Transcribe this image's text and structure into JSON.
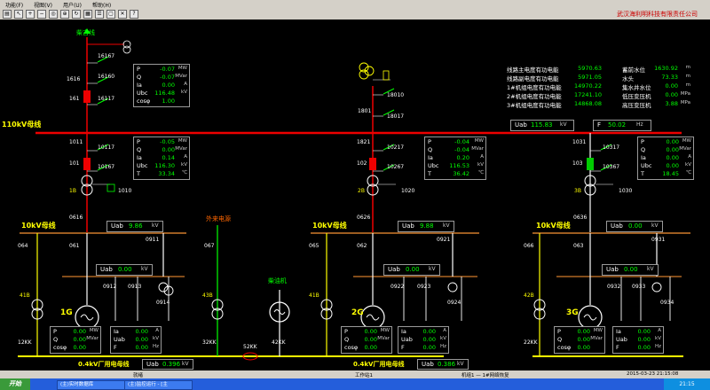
{
  "menu": {
    "items": [
      "功能(F)",
      "视图(V)",
      "用户(U)",
      "帮助(H)"
    ]
  },
  "company": "武汉海利明科技有限责任公司",
  "top": {
    "line_name": "柴古线",
    "bus110": "110kV母线",
    "uab": {
      "label": "Uab",
      "value": "115.83",
      "unit": "kV"
    },
    "f": {
      "label": "F",
      "value": "50.02",
      "unit": "Hz"
    }
  },
  "ext_power": "外来电源",
  "diesel": "柴油机",
  "bus04": "0.4kV厂用电母线",
  "switch_labels": {
    "s1616": "1616",
    "s16167": "16167",
    "s16160": "16160",
    "s16117": "16117",
    "s161": "161",
    "s1801": "1801",
    "s18010": "18010",
    "s18017": "18017",
    "s1011": "1011",
    "s10117": "10117",
    "s101": "101",
    "s10167": "10167",
    "s1B": "1B",
    "s1010": "1010",
    "s1821": "1821",
    "s10217": "10217",
    "s102": "102",
    "s10267": "10267",
    "s2B": "2B",
    "s1020": "1020",
    "s1031": "1031",
    "s10317": "10317",
    "s103": "103",
    "s10367": "10367",
    "s3B": "3B",
    "s1030": "1030",
    "s0616": "0616",
    "s0626": "0626",
    "s0636": "0636",
    "s064": "064",
    "s061": "061",
    "s0911": "0911",
    "s067": "067",
    "s065": "065",
    "s062": "062",
    "s0921": "0921",
    "s066": "066",
    "s063": "063",
    "s0931": "0931",
    "s41B_1": "41B",
    "s43B": "43B",
    "s41B_2": "41B",
    "s42B": "42B",
    "s0912": "0912",
    "s0913": "0913",
    "s0914": "0914",
    "s0922": "0922",
    "s0923": "0923",
    "s0924": "0924",
    "s0932": "0932",
    "s0933": "0933",
    "s0934": "0934",
    "s1G": "1G",
    "s2G": "2G",
    "s3G": "3G",
    "s12KK": "12KK",
    "s32KK": "32KK",
    "s52KK": "52KK",
    "s42KK": "42KK",
    "s22KK": "22KK"
  },
  "panel_line": {
    "rows": [
      {
        "k": "P",
        "v": "-0.07",
        "u": "MW"
      },
      {
        "k": "Q",
        "v": "-0.07",
        "u": "MVar"
      },
      {
        "k": "Ia",
        "v": "0.00",
        "u": "A"
      },
      {
        "k": "Ubc",
        "v": "116.48",
        "u": "kV"
      },
      {
        "k": "cosφ",
        "v": "1.00",
        "u": ""
      }
    ]
  },
  "panel_t1": {
    "rows": [
      {
        "k": "P",
        "v": "-0.05",
        "u": "MW"
      },
      {
        "k": "Q",
        "v": "0.00",
        "u": "MVar"
      },
      {
        "k": "Ia",
        "v": "0.14",
        "u": "A"
      },
      {
        "k": "Ubc",
        "v": "116.30",
        "u": "kV"
      },
      {
        "k": "T",
        "v": "33.34",
        "u": "℃"
      }
    ]
  },
  "panel_t2": {
    "rows": [
      {
        "k": "P",
        "v": "-0.04",
        "u": "MW"
      },
      {
        "k": "Q",
        "v": "-0.04",
        "u": "MVar"
      },
      {
        "k": "Ia",
        "v": "0.20",
        "u": "A"
      },
      {
        "k": "Ubc",
        "v": "116.53",
        "u": "kV"
      },
      {
        "k": "T",
        "v": "36.42",
        "u": "℃"
      }
    ]
  },
  "panel_t3": {
    "rows": [
      {
        "k": "P",
        "v": "0.00",
        "u": "MW"
      },
      {
        "k": "Q",
        "v": "0.00",
        "u": "MVar"
      },
      {
        "k": "Ia",
        "v": "0.00",
        "u": "A"
      },
      {
        "k": "Ubc",
        "v": "0.00",
        "u": "kV"
      },
      {
        "k": "T",
        "v": "18.45",
        "u": "℃"
      }
    ]
  },
  "energy": {
    "rows": [
      {
        "k": "线路主电度有功电能",
        "v": "5970.63"
      },
      {
        "k": "线路副电度有功电能",
        "v": "5971.05"
      },
      {
        "k": "1#机组电度有功电能",
        "v": "14970.22"
      },
      {
        "k": "2#机组电度有功电能",
        "v": "17241.10"
      },
      {
        "k": "3#机组电度有功电能",
        "v": "14868.08"
      }
    ]
  },
  "water": {
    "rows": [
      {
        "k": "蓄前水位",
        "v": "1630.92",
        "u": "m"
      },
      {
        "k": "水头",
        "v": "73.33",
        "u": "m"
      },
      {
        "k": "集水井水位",
        "v": "0.00",
        "u": "m"
      },
      {
        "k": "低压变压机",
        "v": "0.00",
        "u": "MPa"
      },
      {
        "k": "高压变压机",
        "v": "3.88",
        "u": "MPa"
      }
    ]
  },
  "bus10": [
    {
      "name": "10kV母线",
      "uab_label": "Uab",
      "uab": "9.86",
      "unit": "kV"
    },
    {
      "name": "10kV母线",
      "uab_label": "Uab",
      "uab": "9.88",
      "unit": "kV"
    },
    {
      "name": "10kV母线",
      "uab_label": "Uab",
      "uab": "0.00",
      "unit": "kV"
    }
  ],
  "sub_uab": [
    {
      "label": "Uab",
      "value": "0.00",
      "unit": "kV"
    },
    {
      "label": "Uab",
      "value": "0.00",
      "unit": "kV"
    },
    {
      "label": "Uab",
      "value": "0.00",
      "unit": "kV"
    }
  ],
  "gens": [
    {
      "rows": [
        {
          "k": "P",
          "v": "0.00",
          "u": "MW"
        },
        {
          "k": "Q",
          "v": "0.00",
          "u": "MVar"
        },
        {
          "k": "cosφ",
          "v": "0.00",
          "u": ""
        }
      ],
      "rows2": [
        {
          "k": "Ia",
          "v": "0.00",
          "u": "A"
        },
        {
          "k": "Uab",
          "v": "0.00",
          "u": "kV"
        },
        {
          "k": "F",
          "v": "0.00",
          "u": "Hz"
        }
      ]
    },
    {
      "rows": [
        {
          "k": "P",
          "v": "0.00",
          "u": "MW"
        },
        {
          "k": "Q",
          "v": "0.00",
          "u": "MVar"
        },
        {
          "k": "cosφ",
          "v": "0.00",
          "u": ""
        }
      ],
      "rows2": [
        {
          "k": "Ia",
          "v": "0.00",
          "u": "A"
        },
        {
          "k": "Uab",
          "v": "0.00",
          "u": "kV"
        },
        {
          "k": "F",
          "v": "0.00",
          "u": "Hz"
        }
      ]
    },
    {
      "rows": [
        {
          "k": "P",
          "v": "0.00",
          "u": "MW"
        },
        {
          "k": "Q",
          "v": "0.00",
          "u": "MVar"
        },
        {
          "k": "cosφ",
          "v": "0.00",
          "u": ""
        }
      ],
      "rows2": [
        {
          "k": "Ia",
          "v": "0.00",
          "u": "A"
        },
        {
          "k": "Uab",
          "v": "0.00",
          "u": "kV"
        },
        {
          "k": "F",
          "v": "0.00",
          "u": "Hz"
        }
      ]
    }
  ],
  "bus04_uab": [
    {
      "label": "Uab",
      "value": "0.396",
      "unit": "kV"
    },
    {
      "label": "Uab",
      "value": "0.386",
      "unit": "kV"
    }
  ],
  "status": {
    "left": "就绪",
    "center": "工作站1",
    "right1": "机组1 — 1#网络恢复",
    "right2": "2015-03-23 21:15:08"
  },
  "taskbar": {
    "start": "开始",
    "tasks": [
      "(主)实时数据库",
      "(主)监控运行 - [主"
    ],
    "clock": "21:15"
  }
}
